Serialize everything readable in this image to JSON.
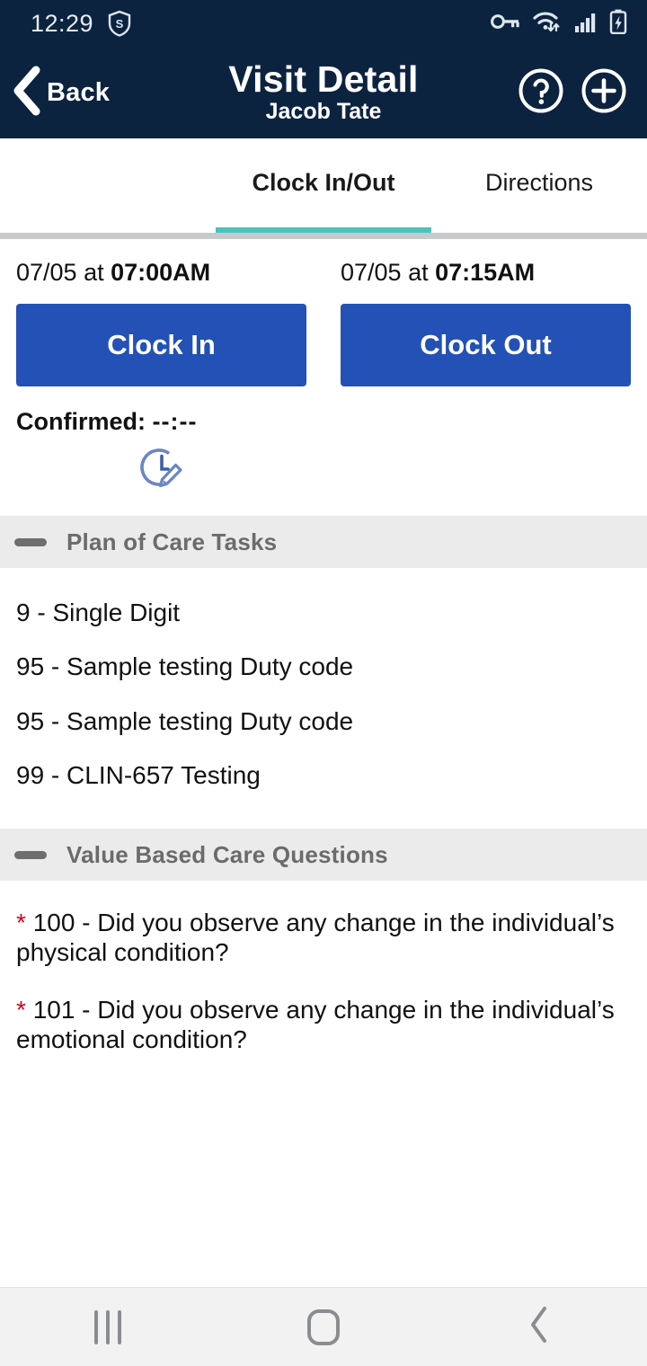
{
  "status_bar": {
    "time": "12:29",
    "icons": [
      "shield-s-badge-icon",
      "vpn-key-icon",
      "wifi-transfer-icon",
      "signal-bars-icon",
      "battery-charging-icon"
    ]
  },
  "app_bar": {
    "back_label": "Back",
    "title": "Visit Detail",
    "subtitle": "Jacob Tate",
    "help_icon": "help-circle-icon",
    "add_icon": "add-circle-icon",
    "background_color": "#0c2340"
  },
  "tabs": {
    "items": [
      {
        "label": "Clock In/Out",
        "active": true
      },
      {
        "label": "Directions",
        "active": false
      }
    ],
    "indicator_color": "#4cc2ba"
  },
  "clock": {
    "clock_in": {
      "stamp_prefix": "07/05 at ",
      "stamp_time": "07:00AM",
      "button_label": "Clock In"
    },
    "clock_out": {
      "stamp_prefix": "07/05 at ",
      "stamp_time": "07:15AM",
      "button_label": "Clock Out"
    },
    "confirmed_label": "Confirmed: ",
    "confirmed_value": "--:--",
    "edit_time_icon": "clock-edit-icon",
    "button_color": "#2351b5"
  },
  "sections": [
    {
      "title": "Plan of Care Tasks",
      "collapse_icon": "collapse-minus-icon",
      "tasks": [
        "9 - Single Digit",
        "95 - Sample testing Duty code",
        "95 - Sample testing Duty code",
        "99 - CLIN-657 Testing"
      ]
    },
    {
      "title": "Value Based Care Questions",
      "collapse_icon": "collapse-minus-icon",
      "questions": [
        {
          "required_marker": "*",
          "text": "100 -  Did you observe any change in the individual’s physical condition?"
        },
        {
          "required_marker": "*",
          "text": "101 -  Did you observe any change in the individual’s emotional condition?"
        }
      ],
      "required_color": "#d0021b"
    }
  ],
  "nav_bar": {
    "recents_icon": "recents-icon",
    "home_icon": "home-icon",
    "back_icon": "back-chevron-icon"
  }
}
